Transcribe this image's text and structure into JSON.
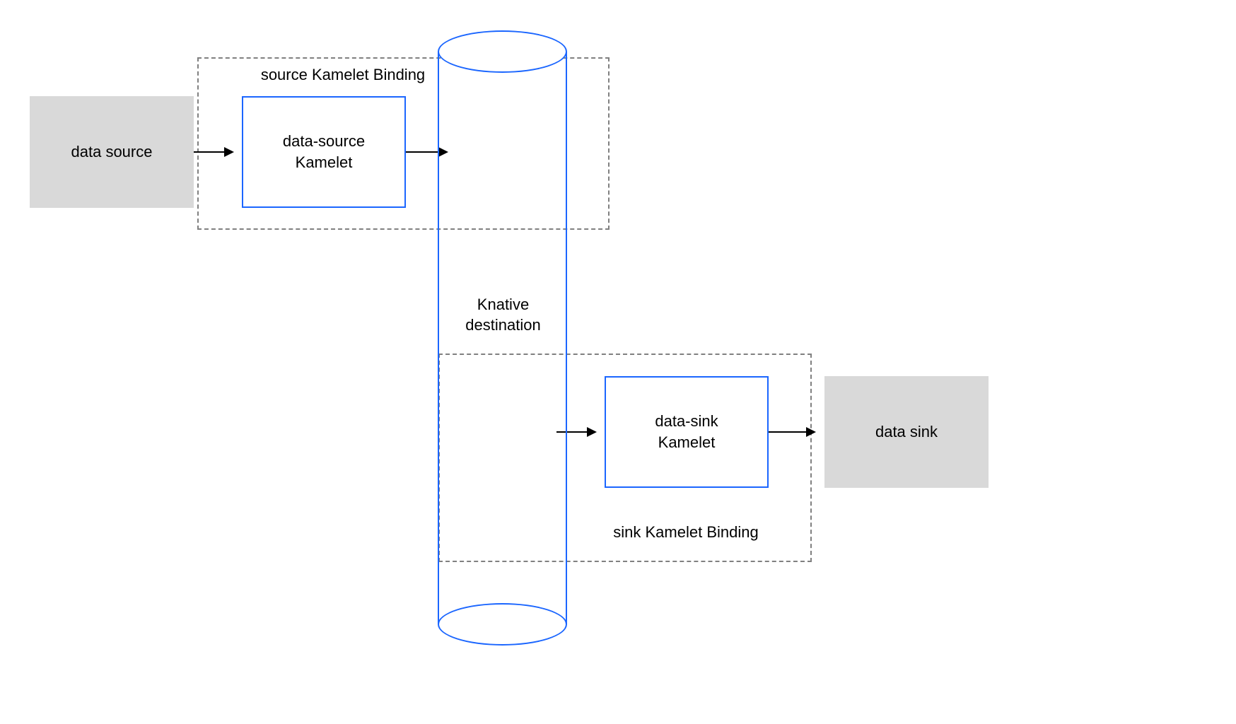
{
  "nodes": {
    "data_source": "data source",
    "data_source_kamelet": "data-source\nKamelet",
    "knative_destination": "Knative\ndestination",
    "data_sink_kamelet": "data-sink\nKamelet",
    "data_sink": "data sink"
  },
  "bindings": {
    "source_binding": "source Kamelet Binding",
    "sink_binding": "sink Kamelet Binding"
  },
  "colors": {
    "gray_fill": "#d9d9d9",
    "blue_stroke": "#1b66ff",
    "dash_stroke": "#808080",
    "arrow": "#000000"
  }
}
